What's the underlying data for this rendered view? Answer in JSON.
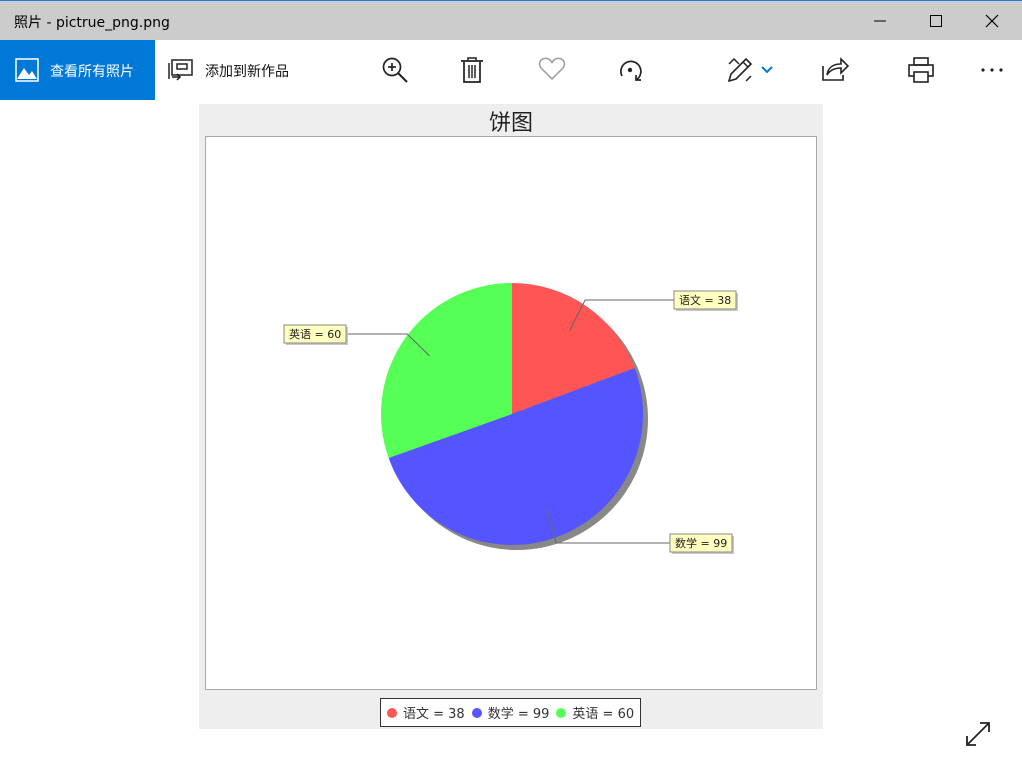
{
  "window": {
    "title": "照片 - pictrue_png.png"
  },
  "toolbar": {
    "view_all_label": "查看所有照片",
    "add_to_creation_label": "添加到新作品",
    "icons": {
      "view_all": "photos-icon",
      "add_to_creation": "add-creation-icon",
      "zoom": "zoom-in-icon",
      "delete": "trash-icon",
      "favorite": "heart-icon",
      "rotate": "rotate-icon",
      "edit": "edit-pencil-icon",
      "share": "share-icon",
      "print": "print-icon",
      "more": "more-icon"
    },
    "accent_color": "#0078d7"
  },
  "chart_data": {
    "type": "pie",
    "title": "饼图",
    "slices": [
      {
        "name": "语文",
        "value": 38,
        "label": "语文 = 38",
        "color": "#ff5555"
      },
      {
        "name": "数学",
        "value": 99,
        "label": "数学 = 99",
        "color": "#5555ff"
      },
      {
        "name": "英语",
        "value": 60,
        "label": "英语 = 60",
        "color": "#55ff55"
      }
    ],
    "start_angle_deg": 90,
    "direction": "clockwise",
    "legend_position": "bottom",
    "background": "#eeeeee",
    "plot_background": "#ffffff"
  }
}
